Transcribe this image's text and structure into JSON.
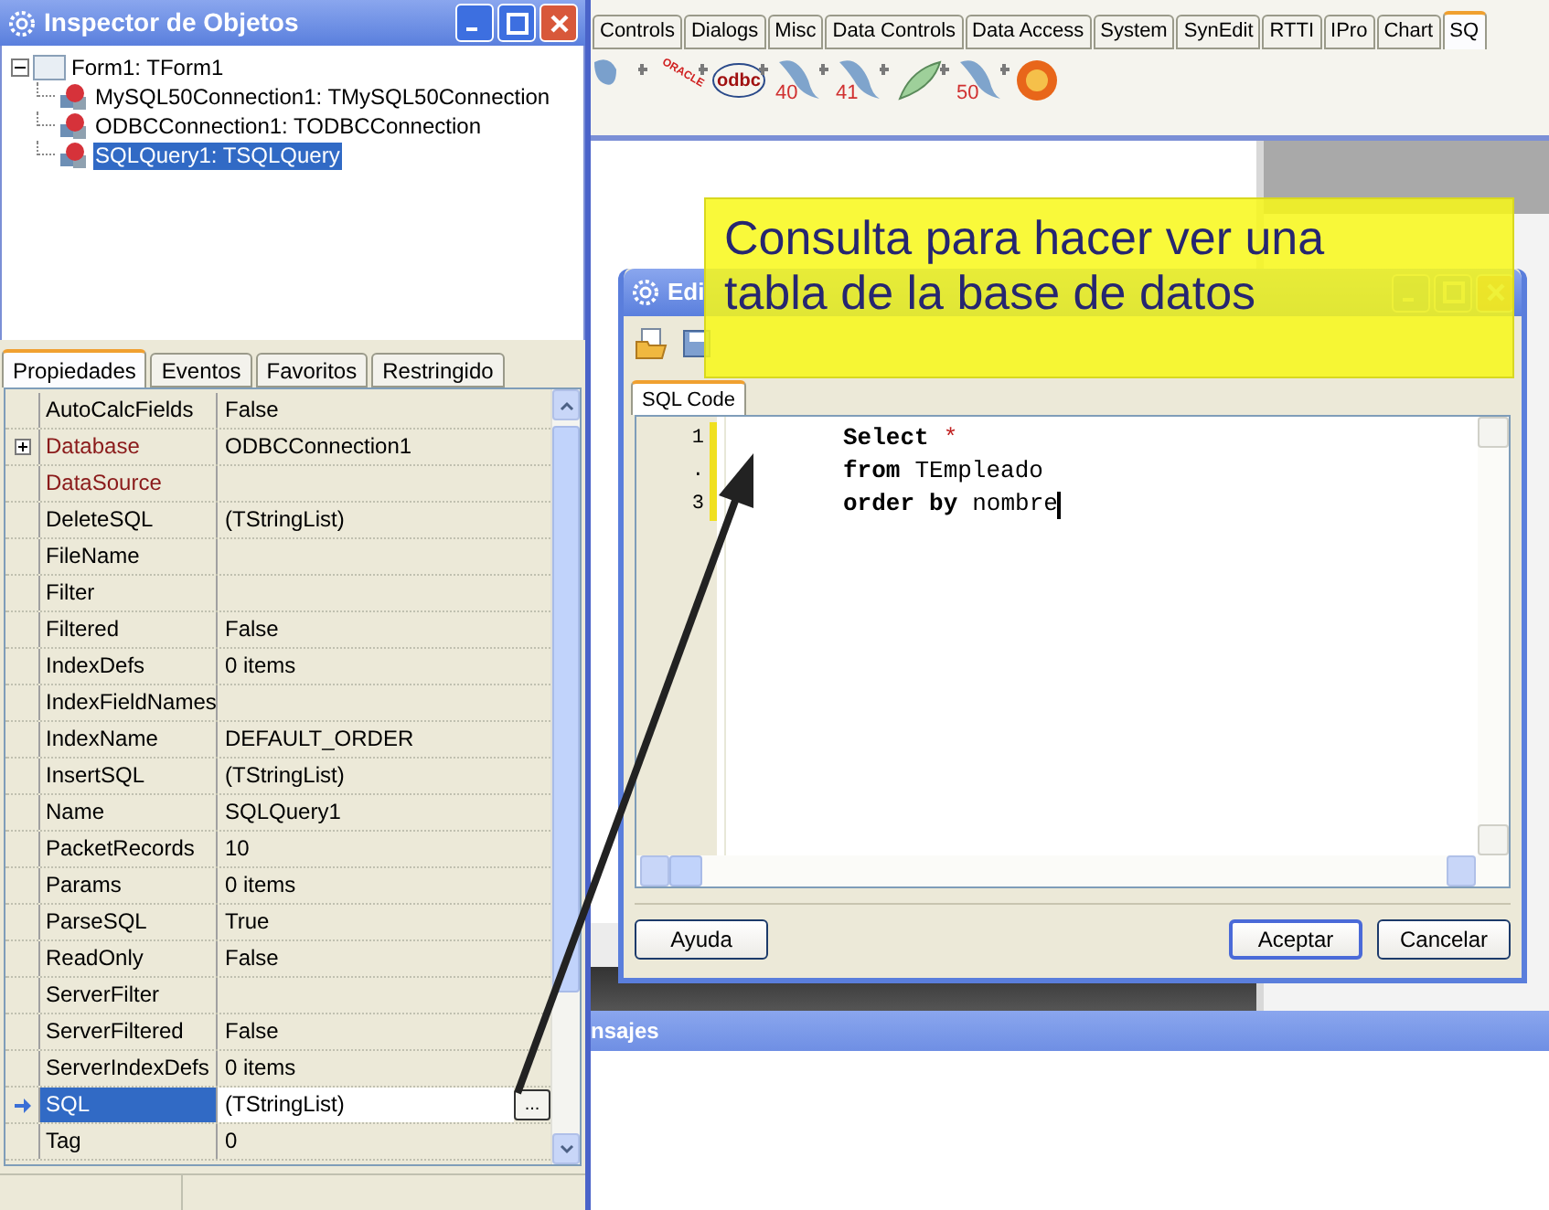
{
  "inspector": {
    "title": "Inspector de Objetos",
    "tree": [
      {
        "label": "Form1: TForm1",
        "kind": "form",
        "expanded": true,
        "selected": false,
        "children": [
          {
            "label": "MySQL50Connection1: TMySQL50Connection",
            "kind": "component",
            "selected": false
          },
          {
            "label": "ODBCConnection1: TODBCConnection",
            "kind": "component",
            "selected": false
          },
          {
            "label": "SQLQuery1: TSQLQuery",
            "kind": "component",
            "selected": true
          }
        ]
      }
    ],
    "tabs": [
      {
        "label": "Propiedades",
        "selected": true
      },
      {
        "label": "Eventos",
        "selected": false
      },
      {
        "label": "Favoritos",
        "selected": false
      },
      {
        "label": "Restringido",
        "selected": false
      }
    ],
    "properties": [
      {
        "name": "AutoCalcFields",
        "value": "False",
        "kind": "plain",
        "selected": false
      },
      {
        "name": "Database",
        "value": "ODBCConnection1",
        "kind": "expandable-reference",
        "selected": false
      },
      {
        "name": "DataSource",
        "kind": "reference",
        "selected": false
      },
      {
        "name": "DeleteSQL",
        "value": "(TStringList)",
        "kind": "plain",
        "selected": false
      },
      {
        "name": "FileName",
        "kind": "plain",
        "selected": false
      },
      {
        "name": "Filter",
        "kind": "plain",
        "selected": false
      },
      {
        "name": "Filtered",
        "value": "False",
        "kind": "plain",
        "selected": false
      },
      {
        "name": "IndexDefs",
        "value": "0 items",
        "kind": "plain",
        "selected": false
      },
      {
        "name": "IndexFieldNames",
        "kind": "plain",
        "selected": false
      },
      {
        "name": "IndexName",
        "value": "DEFAULT_ORDER",
        "kind": "plain",
        "selected": false
      },
      {
        "name": "InsertSQL",
        "value": "(TStringList)",
        "kind": "plain",
        "selected": false
      },
      {
        "name": "Name",
        "value": "SQLQuery1",
        "kind": "plain",
        "selected": false
      },
      {
        "name": "PacketRecords",
        "value": "10",
        "kind": "plain",
        "selected": false
      },
      {
        "name": "Params",
        "value": "0 items",
        "kind": "plain",
        "selected": false
      },
      {
        "name": "ParseSQL",
        "value": "True",
        "kind": "plain",
        "selected": false
      },
      {
        "name": "ReadOnly",
        "value": "False",
        "kind": "plain",
        "selected": false
      },
      {
        "name": "ServerFilter",
        "kind": "plain",
        "selected": false
      },
      {
        "name": "ServerFiltered",
        "value": "False",
        "kind": "plain",
        "selected": false
      },
      {
        "name": "ServerIndexDefs",
        "value": "0 items",
        "kind": "plain",
        "selected": false
      },
      {
        "name": "SQL",
        "value": "(TStringList)",
        "kind": "plain",
        "selected": true,
        "button": "..."
      },
      {
        "name": "Tag",
        "value": "0",
        "kind": "plain",
        "selected": false
      }
    ]
  },
  "palette": {
    "tabs": [
      {
        "label": "Controls",
        "selected": false
      },
      {
        "label": "Dialogs",
        "selected": false
      },
      {
        "label": "Misc",
        "selected": false
      },
      {
        "label": "Data Controls",
        "selected": false
      },
      {
        "label": "Data Access",
        "selected": false
      },
      {
        "label": "System",
        "selected": false
      },
      {
        "label": "SynEdit",
        "selected": false
      },
      {
        "label": "RTTI",
        "selected": false
      },
      {
        "label": "IPro",
        "selected": false
      },
      {
        "label": "Chart",
        "selected": false
      },
      {
        "label": "SQ",
        "selected": true
      }
    ],
    "components": [
      {
        "kind": "elephant"
      },
      {
        "kind": "oracle",
        "text": "ORACLE"
      },
      {
        "kind": "odbc",
        "text": "odbc"
      },
      {
        "kind": "dolphin",
        "text": "40"
      },
      {
        "kind": "dolphin",
        "text": "41"
      },
      {
        "kind": "feather"
      },
      {
        "kind": "dolphin",
        "text": "50"
      },
      {
        "kind": "firebird"
      }
    ]
  },
  "messages_panel": {
    "title": "nsajes"
  },
  "sql_editor": {
    "title": "Edi",
    "tab": "SQL Code",
    "lines": [
      {
        "number": "1",
        "modified": true,
        "cursor": false,
        "tokens": [
          {
            "text": "Select",
            "kind": "keyword"
          },
          {
            "text": "*",
            "kind": "symbol"
          }
        ]
      },
      {
        "number": ".",
        "modified": true,
        "cursor": false,
        "tokens": [
          {
            "text": "from",
            "kind": "keyword"
          },
          {
            "text": "TEmpleado",
            "kind": "identifier"
          }
        ]
      },
      {
        "number": "3",
        "modified": true,
        "cursor": true,
        "tokens": [
          {
            "text": "order",
            "kind": "keyword"
          },
          {
            "text": "by",
            "kind": "keyword"
          },
          {
            "text": "nombre",
            "kind": "identifier"
          }
        ]
      }
    ],
    "buttons": [
      {
        "label": "Ayuda",
        "default": false
      },
      {
        "label": "Aceptar",
        "default": true
      },
      {
        "label": "Cancelar",
        "default": false
      }
    ]
  },
  "note": {
    "text": "Consulta para hacer ver una tabla de la base de datos"
  }
}
